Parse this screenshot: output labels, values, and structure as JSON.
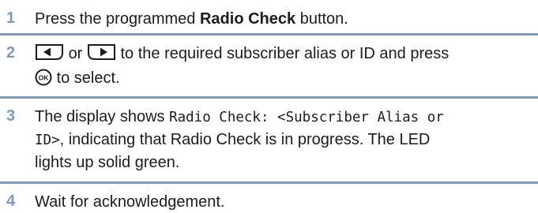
{
  "steps": [
    {
      "number": "1",
      "before": "Press the programmed ",
      "bold": "Radio Check",
      "after": " button."
    },
    {
      "number": "2",
      "key_left_icon": "left-arrow-key-icon",
      "connector": "or",
      "key_right_icon": "right-arrow-key-icon",
      "text_a": "to the required subscriber alias or ID and press",
      "ok_icon": "ok-button-icon",
      "text_b": "to select."
    },
    {
      "number": "3",
      "before": "The display shows ",
      "display_text_1": "Radio Check: <Subscriber Alias or",
      "display_text_2": "ID>",
      "after_line2": ", indicating that Radio Check is in progress. The LED",
      "line3": "lights up solid green."
    },
    {
      "number": "4",
      "text": "Wait for acknowledgement."
    }
  ]
}
